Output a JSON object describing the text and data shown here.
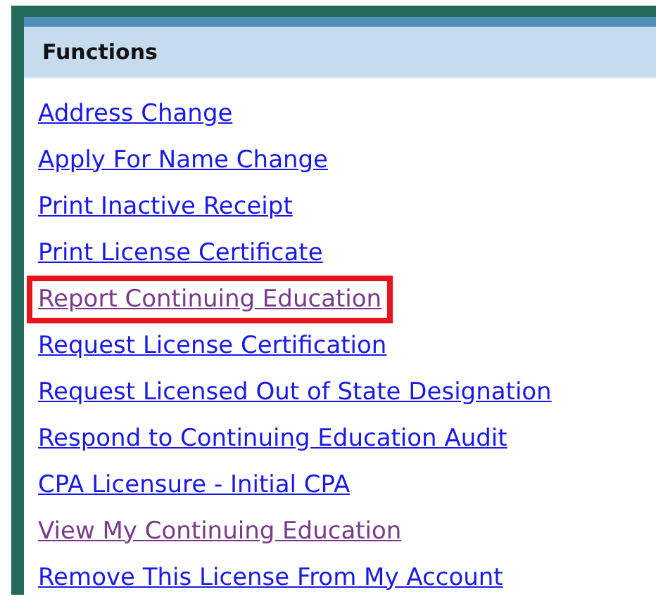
{
  "panel": {
    "title": "Functions"
  },
  "links": [
    {
      "label": "Address Change",
      "visited": false,
      "highlighted": false
    },
    {
      "label": "Apply For Name Change",
      "visited": false,
      "highlighted": false
    },
    {
      "label": "Print Inactive Receipt",
      "visited": false,
      "highlighted": false
    },
    {
      "label": "Print License Certificate",
      "visited": false,
      "highlighted": false
    },
    {
      "label": "Report Continuing Education",
      "visited": true,
      "highlighted": true
    },
    {
      "label": "Request License Certification",
      "visited": false,
      "highlighted": false
    },
    {
      "label": "Request Licensed Out of State Designation",
      "visited": false,
      "highlighted": false
    },
    {
      "label": "Respond to Continuing Education Audit",
      "visited": false,
      "highlighted": false
    },
    {
      "label": "CPA Licensure - Initial CPA",
      "visited": false,
      "highlighted": false
    },
    {
      "label": "View My Continuing Education",
      "visited": true,
      "highlighted": false
    },
    {
      "label": "Remove This License From My Account",
      "visited": false,
      "highlighted": false
    }
  ]
}
